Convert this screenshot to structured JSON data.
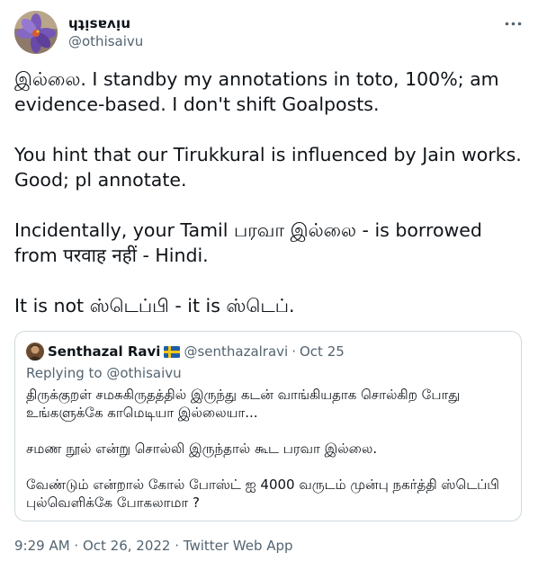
{
  "author": {
    "display_name": "ɥʇᴉsɐʌᴉu",
    "handle": "@othisaivu"
  },
  "tweet": {
    "paragraphs": [
      "இல்லை. I standby my annotations in toto, 100%; am evidence-based. I don't shift Goalposts.",
      "You hint that our Tirukkural is influenced by Jain works. Good; pl annotate.",
      "Incidentally, your Tamil பரவா இல்லை - is borrowed from परवाह नहीं - Hindi.",
      "It is not ஸ்டெப்பி - it is ஸ்டெப்."
    ]
  },
  "quoted": {
    "display_name": "Senthazal Ravi",
    "handle": "@senthazalravi",
    "separator": "·",
    "time": "Oct 25",
    "replying_prefix": "Replying to",
    "replying_to": "@othisaivu",
    "paragraphs": [
      "திருக்குறள் சமசுகிருதத்தில் இருந்து கடன் வாங்கியதாக சொல்கிற போது உங்களுக்கே காமெடியா இல்லையா...",
      "சமண நூல் என்று சொல்லி இருந்தால் கூட பரவா இல்லை.",
      "வேண்டும் என்றால் கோல் போஸ்ட் ஐ 4000 வருடம் முன்பு நகர்த்தி ஸ்டெப்பி புல்வெளிக்கே போகலாமா ?"
    ]
  },
  "meta": {
    "line": "9:29 AM · Oct 26, 2022 · Twitter Web App"
  },
  "icons": {
    "more": "more-horizontal-icon",
    "flag": "sweden-flag-icon"
  },
  "colors": {
    "text_primary": "#0f1419",
    "text_secondary": "#536471",
    "border": "#cfd9de",
    "avatar_purple": "#7b5bb7"
  }
}
